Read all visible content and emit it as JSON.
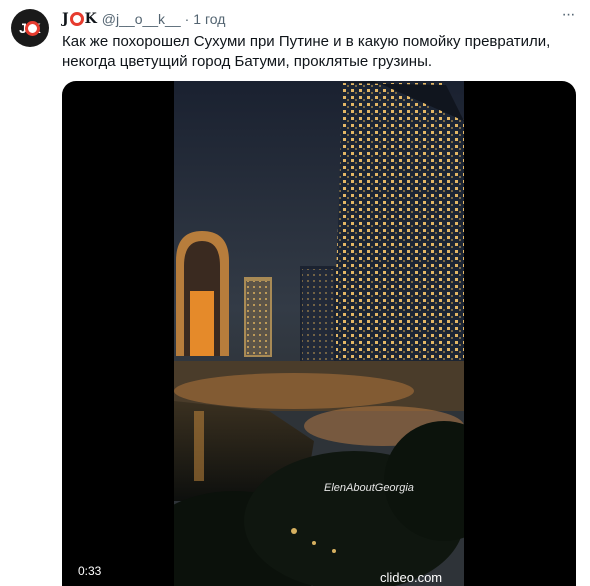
{
  "author": {
    "display_name_prefix": "J",
    "display_name_suffix": "K",
    "avatar_text": "J  K",
    "handle": "@j__o__k__",
    "time": "1 год"
  },
  "tweet": {
    "text": "Как же похорошел Сухуми при Путине и в какую помойку превратили,\nнекогда цветущий город Батуми, проклятые грузины."
  },
  "video": {
    "timer": "0:33",
    "watermark_channel": "ElenAboutGeorgia",
    "watermark_site": "clideo.com"
  },
  "colors": {
    "accent_red": "#e63b2e",
    "secondary_text": "#536471",
    "primary_text": "#0f1419"
  },
  "icons": {
    "more": "more-dots-icon",
    "logo_ring": "lifebuoy-icon"
  }
}
